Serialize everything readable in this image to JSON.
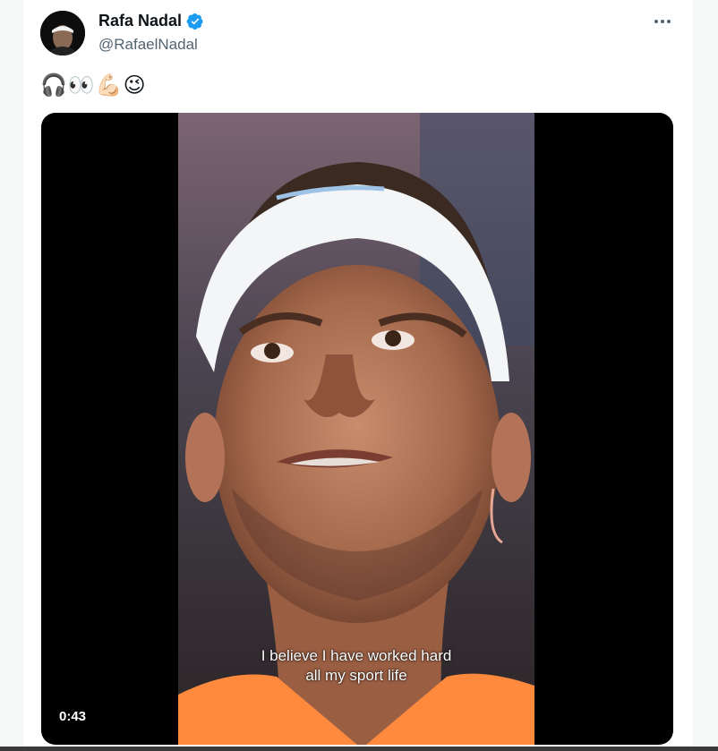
{
  "author": {
    "display_name": "Rafa Nadal",
    "handle": "@RafaelNadal",
    "verified_icon": "verified-badge-icon",
    "verified_color": "#1d9bf0"
  },
  "tweet": {
    "text": "🎧👀💪🏻😉"
  },
  "video": {
    "subtitle_line1": "I believe I have worked hard",
    "subtitle_line2": "all my sport life",
    "duration": "0:43"
  },
  "icons": {
    "more": "more-options-icon"
  }
}
